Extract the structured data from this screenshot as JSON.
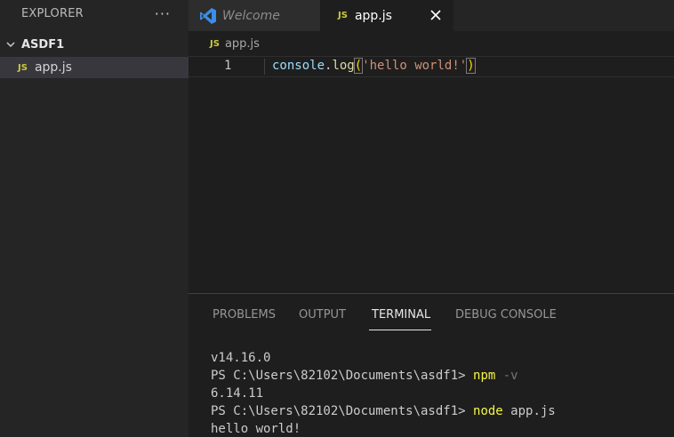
{
  "sidebar": {
    "title": "EXPLORER",
    "more_label": "···",
    "folder_name": "ASDF1",
    "file_icon_label": "JS",
    "file_name": "app.js"
  },
  "tabs": [
    {
      "label": "Welcome",
      "icon": "vscode-icon",
      "active": false
    },
    {
      "label": "app.js",
      "icon_label": "JS",
      "active": true
    }
  ],
  "breadcrumb": {
    "icon_label": "JS",
    "label": "app.js"
  },
  "editor": {
    "line_number": "1",
    "code": {
      "object": "console",
      "dot": ".",
      "function": "log",
      "open_paren": "(",
      "string": "'hello world!'",
      "close_paren": ")"
    }
  },
  "panel": {
    "tabs": [
      "PROBLEMS",
      "OUTPUT",
      "TERMINAL",
      "DEBUG CONSOLE"
    ],
    "active_tab": "TERMINAL",
    "terminal": {
      "line1": "v14.16.0",
      "prompt": "PS C:\\Users\\82102\\Documents\\asdf1> ",
      "cmd1": "npm",
      "cmd1_args": " -v",
      "line3": "6.14.11",
      "cmd2": "node",
      "cmd2_args": " app.js",
      "line5": "hello world!"
    }
  },
  "colors": {
    "js_icon": "#cbcb41",
    "vscode_blue": "#3b8eea",
    "terminal_cmd": "#f5f543",
    "string": "#ce9178"
  }
}
